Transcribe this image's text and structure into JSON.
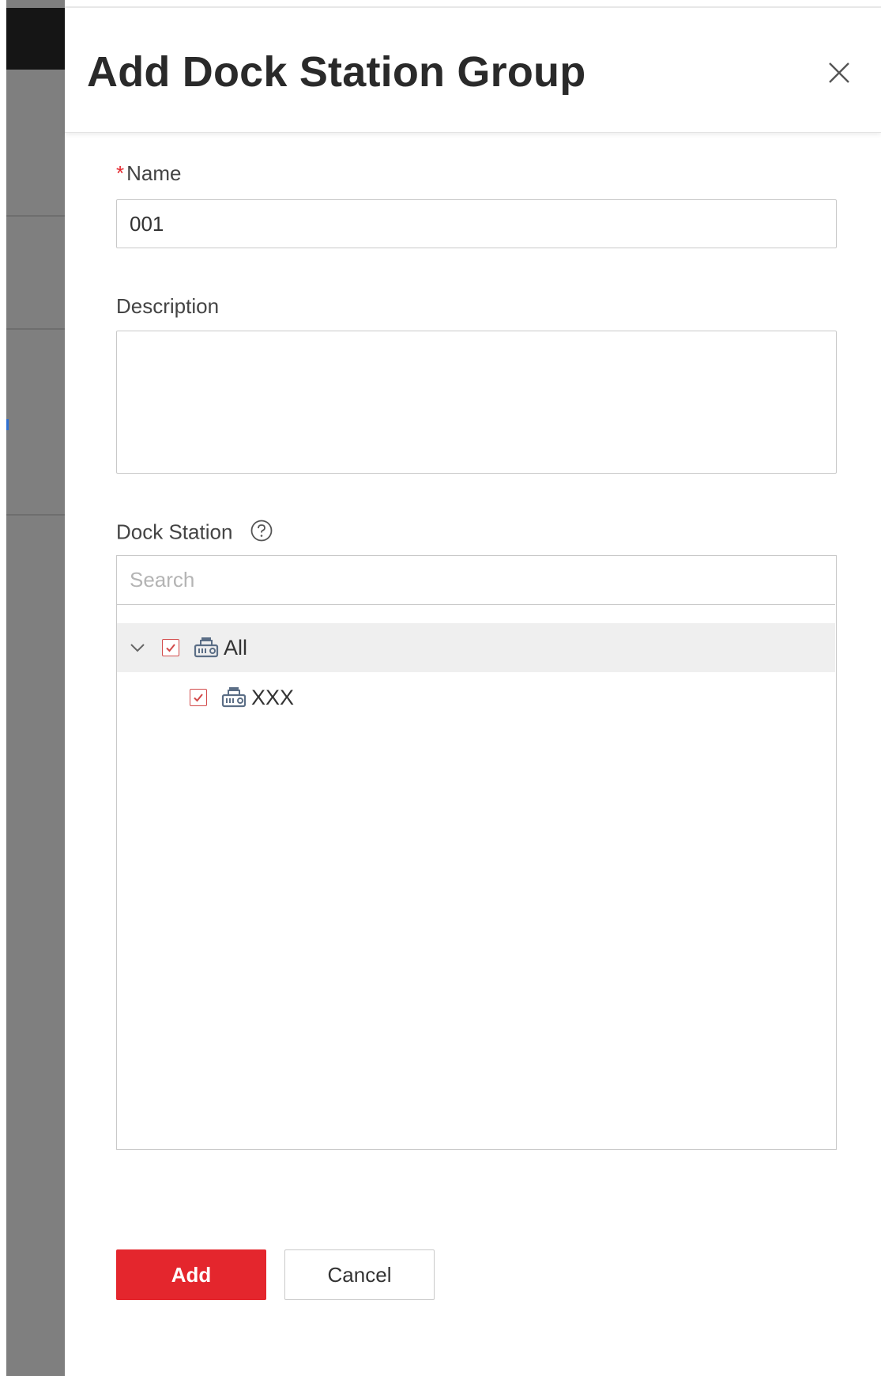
{
  "dialog": {
    "title": "Add Dock Station Group"
  },
  "form": {
    "name": {
      "required_mark": "*",
      "label": "Name",
      "value": "001"
    },
    "description": {
      "label": "Description",
      "value": ""
    },
    "dock_station": {
      "label": "Dock Station",
      "help_icon": "question-circle-icon",
      "search_placeholder": "Search",
      "tree": [
        {
          "label": "All",
          "checked": true,
          "expanded": true,
          "icon": "dock-station-icon"
        },
        {
          "label": "XXX",
          "checked": true,
          "icon": "dock-station-icon"
        }
      ]
    }
  },
  "actions": {
    "add_label": "Add",
    "cancel_label": "Cancel"
  },
  "colors": {
    "accent": "#e4262d",
    "checkmark": "#d24a4a",
    "overlay": "#7f7f7f"
  }
}
